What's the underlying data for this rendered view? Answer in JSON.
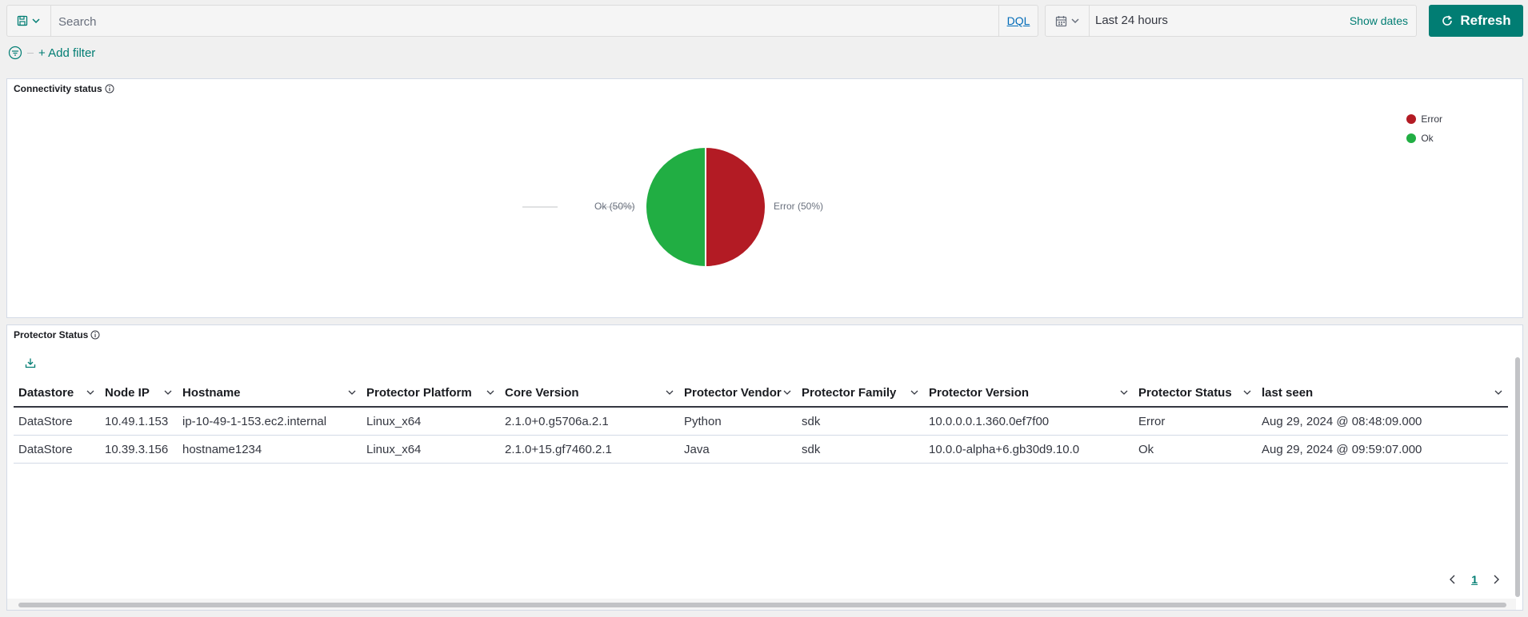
{
  "query": {
    "placeholder": "Search",
    "language": "DQL"
  },
  "time": {
    "range": "Last 24 hours",
    "show_dates": "Show dates"
  },
  "refresh_label": "Refresh",
  "add_filter": "+ Add filter",
  "connectivity": {
    "title": "Connectivity status",
    "legend": [
      {
        "label": "Error",
        "color": "#b31b24"
      },
      {
        "label": "Ok",
        "color": "#21ae43"
      }
    ],
    "slice_labels": {
      "ok": "Ok (50%)",
      "error": "Error (50%)"
    }
  },
  "chart_data": {
    "type": "pie",
    "categories": [
      "Error",
      "Ok"
    ],
    "values": [
      50,
      50
    ],
    "colors": [
      "#b31b24",
      "#21ae43"
    ]
  },
  "protector": {
    "title": "Protector Status",
    "columns": [
      "Datastore",
      "Node IP",
      "Hostname",
      "Protector Platform",
      "Core Version",
      "Protector Vendor",
      "Protector Family",
      "Protector Version",
      "Protector Status",
      "last seen"
    ],
    "rows": [
      [
        "DataStore",
        "10.49.1.153",
        "ip-10-49-1-153.ec2.internal",
        "Linux_x64",
        "2.1.0+0.g5706a.2.1",
        "Python",
        "sdk",
        "10.0.0.0.1.360.0ef7f00",
        "Error",
        "Aug 29, 2024 @ 08:48:09.000"
      ],
      [
        "DataStore",
        "10.39.3.156",
        "hostname1234",
        "Linux_x64",
        "2.1.0+15.gf7460.2.1",
        "Java",
        "sdk",
        "10.0.0-alpha+6.gb30d9.10.0",
        "Ok",
        "Aug 29, 2024 @ 09:59:07.000"
      ]
    ],
    "page": "1"
  }
}
